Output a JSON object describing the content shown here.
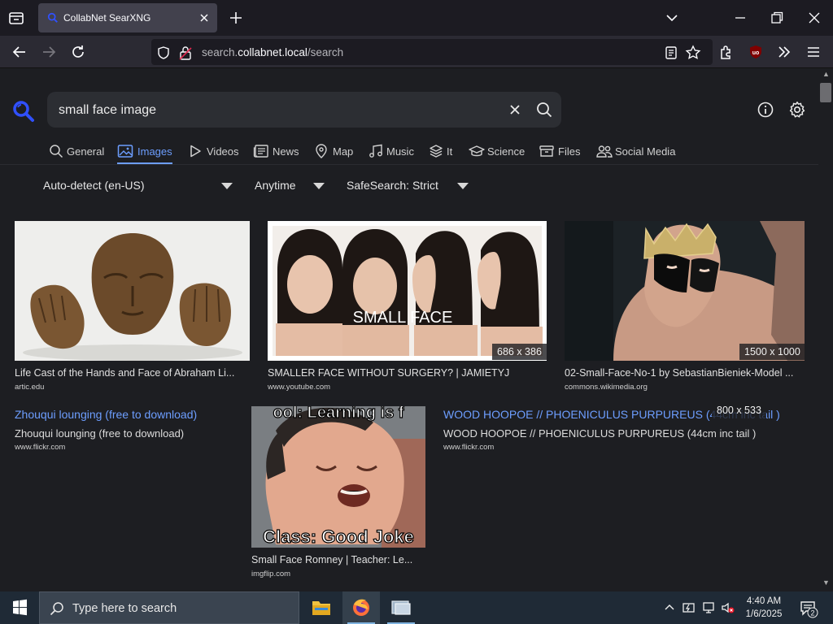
{
  "browser": {
    "tab_title": "CollabNet SearXNG",
    "url_prefix": "search.",
    "url_host": "collabnet.local",
    "url_path": "/search"
  },
  "search": {
    "query": "small face image"
  },
  "categories": [
    {
      "label": "General",
      "icon": "search-icon"
    },
    {
      "label": "Images",
      "icon": "image-icon",
      "active": true
    },
    {
      "label": "Videos",
      "icon": "play-icon"
    },
    {
      "label": "News",
      "icon": "newspaper-icon"
    },
    {
      "label": "Map",
      "icon": "map-pin-icon"
    },
    {
      "label": "Music",
      "icon": "music-note-icon"
    },
    {
      "label": "It",
      "icon": "layers-icon"
    },
    {
      "label": "Science",
      "icon": "graduation-cap-icon"
    },
    {
      "label": "Files",
      "icon": "archive-icon"
    },
    {
      "label": "Social Media",
      "icon": "people-icon"
    }
  ],
  "filters": {
    "language": "Auto-detect (en-US)",
    "time": "Anytime",
    "safesearch": "SafeSearch: Strict"
  },
  "results": [
    {
      "title": "Life Cast of the Hands and Face of Abraham Li...",
      "source": "artic.edu",
      "resolution": ""
    },
    {
      "title": "SMALLER FACE WITHOUT SURGERY? | JAMIETYJ",
      "source": "www.youtube.com",
      "resolution": "686 x 386",
      "overlay_text": "SMALL FACE"
    },
    {
      "title": "02-Small-Face-No-1 by SebastianBieniek-Model ...",
      "source": "commons.wikimedia.org",
      "resolution": "1500 x 1000"
    },
    {
      "title": "Zhouqui lounging (free to download)",
      "subtitle": "Zhouqui lounging (free to download)",
      "source": "www.flickr.com"
    },
    {
      "title": "Small Face Romney | Teacher: Le...",
      "source": "imgflip.com",
      "meme_top": "ool: Learning is f",
      "meme_bottom": "Class: Good Joke"
    },
    {
      "title": "WOOD HOOPOE // PHOENICULUS PURPUREUS (44cm inc tail )",
      "subtitle": "WOOD HOOPOE // PHOENICULUS PURPUREUS (44cm inc tail )",
      "source": "www.flickr.com",
      "resolution": "800 x 533"
    }
  ],
  "taskbar": {
    "search_placeholder": "Type here to search",
    "time": "4:40 AM",
    "date": "1/6/2025",
    "notifications": "2"
  },
  "colors": {
    "accent": "#6d9eff",
    "page_bg": "#1d1e22",
    "search_bg": "#2c2e33"
  }
}
